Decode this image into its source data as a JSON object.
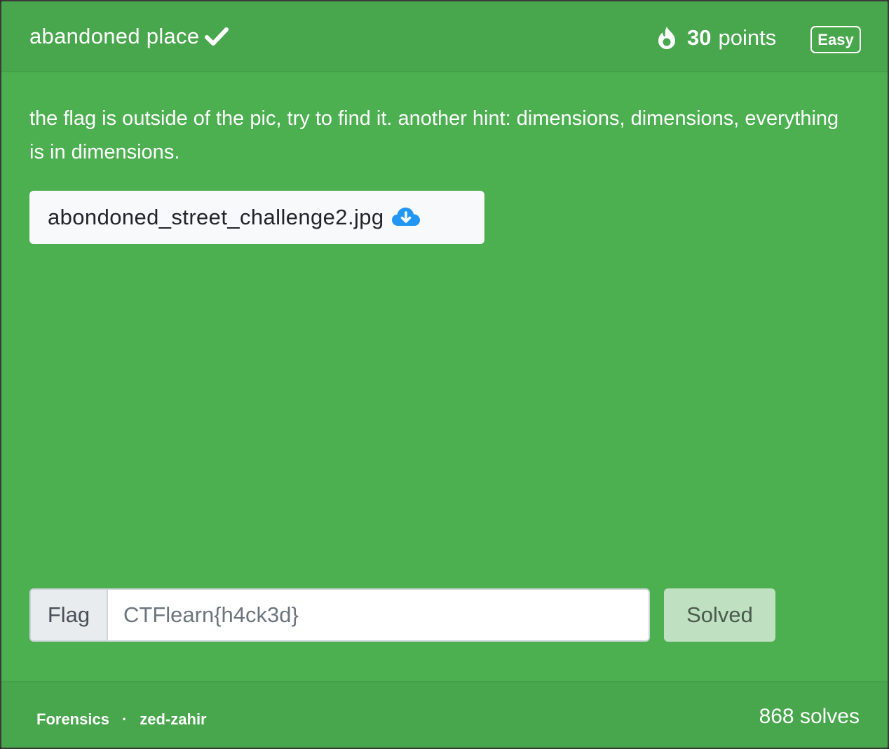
{
  "challenge": {
    "title": "abandoned place",
    "points_value": "30",
    "points_label": "points",
    "difficulty": "Easy",
    "description": "the flag is outside of the pic, try to find it. another hint: dimensions, dimensions, everything is in dimensions.",
    "file_name": "abondoned_street_challenge2.jpg"
  },
  "flag_form": {
    "label": "Flag",
    "value": "CTFlearn{h4ck3d}",
    "submit_label": "Solved"
  },
  "footer": {
    "category": "Forensics",
    "separator": "·",
    "author": "zed-zahir",
    "solves": "868 solves"
  },
  "colors": {
    "card_bg": "#4caf50",
    "header_bg": "#48a74c",
    "file_btn_bg": "#f8f9fa",
    "solved_btn_bg": "#bfe0c1",
    "download_icon": "#2196f3"
  },
  "icons": [
    "check-icon",
    "flame-icon",
    "cloud-download-icon"
  ]
}
